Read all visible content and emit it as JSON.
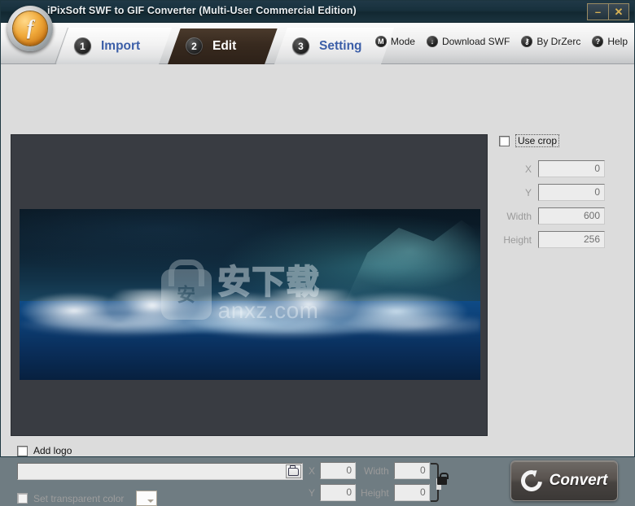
{
  "window": {
    "title": "iPixSoft SWF to GIF Converter (Multi-User Commercial Edition)",
    "logo_icon": "flash-logo-icon",
    "minimize_label": "–",
    "minimize_icon": "minimize-icon",
    "close_label": "✕",
    "close_icon": "close-icon"
  },
  "tabs": [
    {
      "number": "1",
      "label": "Import",
      "active": false
    },
    {
      "number": "2",
      "label": "Edit",
      "active": true
    },
    {
      "number": "3",
      "label": "Setting",
      "active": false
    }
  ],
  "top_menu": [
    {
      "icon": "mode-icon",
      "glyph": "M",
      "label": "Mode"
    },
    {
      "icon": "download-icon",
      "glyph": "↓",
      "label": "Download SWF"
    },
    {
      "icon": "key-icon",
      "glyph": "⚷",
      "label": "By DrZerc"
    },
    {
      "icon": "help-icon",
      "glyph": "?",
      "label": "Help"
    }
  ],
  "preview": {
    "watermark_cn": "安下载",
    "watermark_url": "anxz.com",
    "watermark_badge_glyph": "安"
  },
  "crop_panel": {
    "use_crop_label": "Use crop",
    "use_crop_checked": false,
    "fields": [
      {
        "label": "X",
        "value": "0"
      },
      {
        "label": "Y",
        "value": "0"
      },
      {
        "label": "Width",
        "value": "600"
      },
      {
        "label": "Height",
        "value": "256"
      }
    ]
  },
  "logo_panel": {
    "add_logo_label": "Add logo",
    "add_logo_checked": false,
    "path_value": "",
    "path_placeholder": "",
    "browse_icon": "open-folder-icon",
    "transparent_label": "Set transparent color",
    "transparent_checked": false,
    "color_swatch": "#ffffff",
    "position_fields": [
      {
        "label": "X",
        "value": "0"
      },
      {
        "label": "Width",
        "value": "0"
      },
      {
        "label": "Y",
        "value": "0"
      },
      {
        "label": "Height",
        "value": "0"
      }
    ],
    "lock_icon": "lock-aspect-ratio-icon"
  },
  "convert": {
    "label": "Convert",
    "icon": "refresh-circle-icon"
  },
  "colors": {
    "titlebar": "#17303c",
    "active_tab": "#382a1f",
    "tab_text": "#3c5fa8",
    "panel_bg": "#dcdcdc",
    "preview_bg": "#393c42",
    "convert_btn": "#59534f"
  }
}
